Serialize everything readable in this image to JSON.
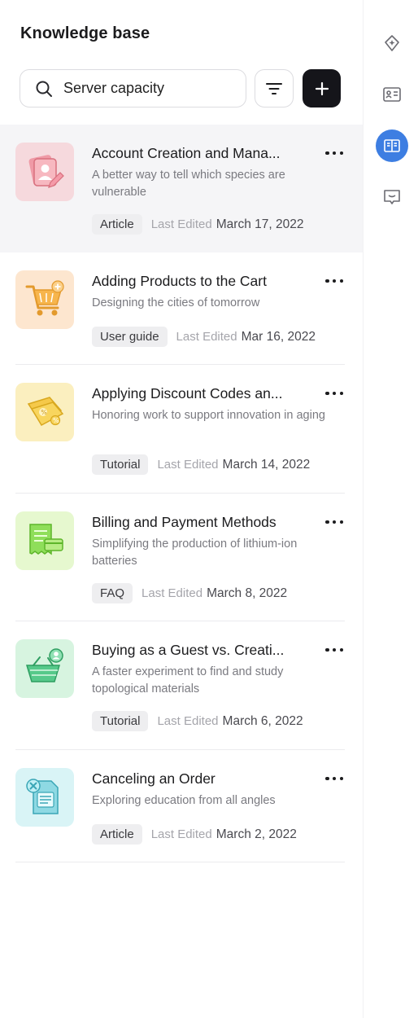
{
  "header": {
    "title": "Knowledge base"
  },
  "search": {
    "value": "Server capacity",
    "icon": "search-icon"
  },
  "toolbar": {
    "filter_icon": "filter-icon",
    "add_icon": "plus-icon"
  },
  "articles": [
    {
      "title": "Account Creation and Mana...",
      "description": "A better way to tell which species are vulnerable",
      "tag": "Article",
      "edited_label": "Last Edited",
      "date": "March 17, 2022",
      "icon": "account-user-icon",
      "accent": "#f6d9dd",
      "selected": true
    },
    {
      "title": "Adding Products to the Cart",
      "description": "Designing the cities of tomorrow",
      "tag": "User guide",
      "edited_label": "Last Edited",
      "date": "Mar 16, 2022",
      "icon": "shopping-cart-icon",
      "accent": "#fde6cf"
    },
    {
      "title": "Applying Discount Codes an...",
      "description": "Honoring work to support innovation in aging",
      "tag": "Tutorial",
      "edited_label": "Last Edited",
      "date": "March 14, 2022",
      "icon": "discount-tag-icon",
      "accent": "#fbefbf"
    },
    {
      "title": "Billing and Payment Methods",
      "description": "Simplifying the production of lithium-ion batteries",
      "tag": "FAQ",
      "edited_label": "Last Edited",
      "date": "March 8, 2022",
      "icon": "receipt-card-icon",
      "accent": "#e6f8cf"
    },
    {
      "title": "Buying as a Guest vs. Creati...",
      "description": "A faster experiment to find and study topological materials",
      "tag": "Tutorial",
      "edited_label": "Last Edited",
      "date": "March 6, 2022",
      "icon": "guest-basket-icon",
      "accent": "#d7f4e0"
    },
    {
      "title": "Canceling an Order",
      "description": "Exploring education from all angles",
      "tag": "Article",
      "edited_label": "Last Edited",
      "date": "March 2, 2022",
      "icon": "cancel-document-icon",
      "accent": "#d9f4f6"
    }
  ],
  "rail": [
    {
      "icon": "diamond-sparkle-icon"
    },
    {
      "icon": "contact-card-icon"
    },
    {
      "icon": "knowledge-book-icon",
      "active": true,
      "accent": "#3d7ee2"
    },
    {
      "icon": "chat-message-icon"
    }
  ]
}
